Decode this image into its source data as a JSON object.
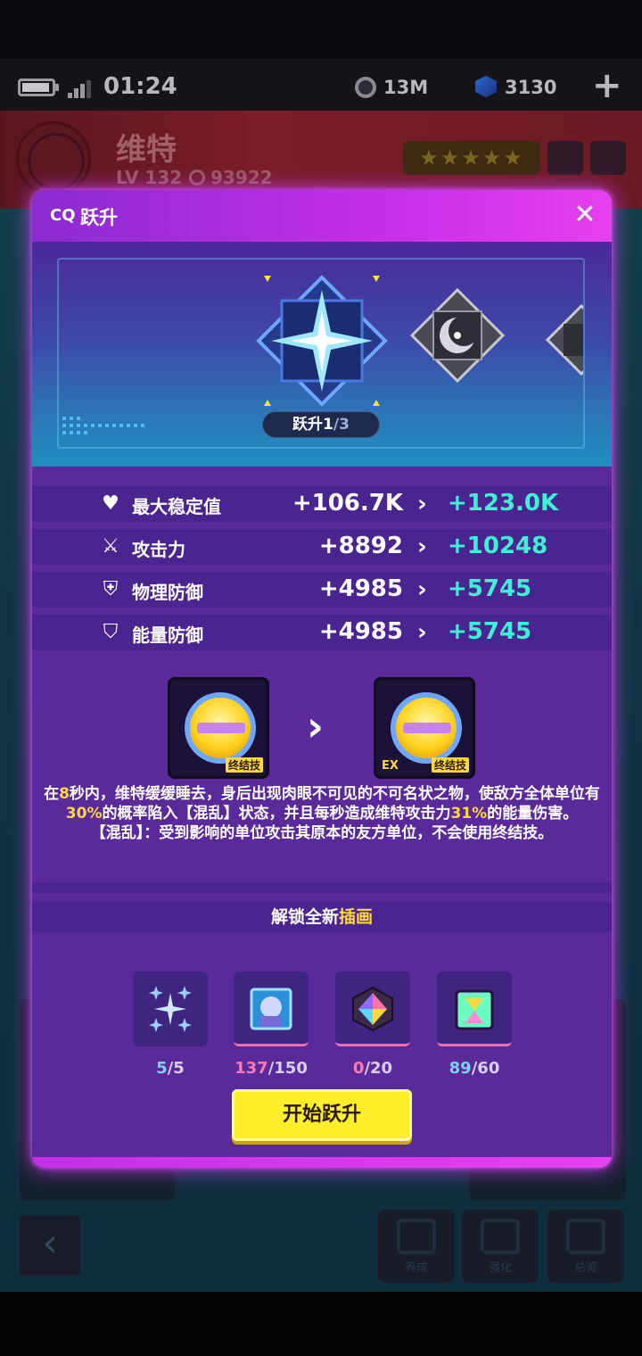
{
  "status": {
    "time": "01:24",
    "coins": "13M",
    "gems": "3130"
  },
  "character": {
    "name": "维特",
    "level": "LV 132",
    "power": "93922",
    "stars": "★★★★★"
  },
  "modal": {
    "title": "跃升",
    "title_icon": "ascend-icon",
    "rank": {
      "current": "1",
      "label": "跃升",
      "max": "/3"
    },
    "stats": [
      {
        "icon": "heart-pulse-icon",
        "glyph": "♥",
        "name": "最大稳定值",
        "old": "+106.7K",
        "new": "+123.0K"
      },
      {
        "icon": "sword-icon",
        "glyph": "⚔",
        "name": "攻击力",
        "old": "+8892",
        "new": "+10248"
      },
      {
        "icon": "shield-alert-icon",
        "glyph": "⛨",
        "name": "物理防御",
        "old": "+4985",
        "new": "+5745"
      },
      {
        "icon": "shield-bolt-icon",
        "glyph": "⛉",
        "name": "能量防御",
        "old": "+4985",
        "new": "+5745"
      }
    ],
    "skill": {
      "tag": "终结技",
      "ex_tag": "EX"
    },
    "description": {
      "p1": "在",
      "v1": "8",
      "p2": "秒内，维特缓缓睡去，身后出现肉眼不可见的不可名状之物，使敌方全体单位有",
      "v2": "30%",
      "p3": "的概率陷入【混乱】状态，并且每秒造成维特攻击力",
      "v3": "31%",
      "p4": "的能量伤害。",
      "line2": "【混乱】：受到影响的单位攻击其原本的友方单位，不会使用终结技。"
    },
    "unlock": {
      "prefix": "解锁全新",
      "highlight": "插画"
    },
    "materials": [
      {
        "icon": "sparkle-stars-icon",
        "have": "5",
        "need": "/5"
      },
      {
        "icon": "character-portrait-icon",
        "have": "137",
        "need": "/150"
      },
      {
        "icon": "prism-crystal-icon",
        "have": "0",
        "need": "/20"
      },
      {
        "icon": "hourglass-cube-icon",
        "have": "89",
        "need": "/60"
      }
    ],
    "start_button": "开始跃升"
  },
  "nav": {
    "tab1": "养成",
    "tab2": "强化",
    "tab3": "总览"
  },
  "colors": {
    "accent": "#c52fe8",
    "gain": "#3ef0d6",
    "highlight": "#ffd93b",
    "button": "#ffee2a"
  }
}
